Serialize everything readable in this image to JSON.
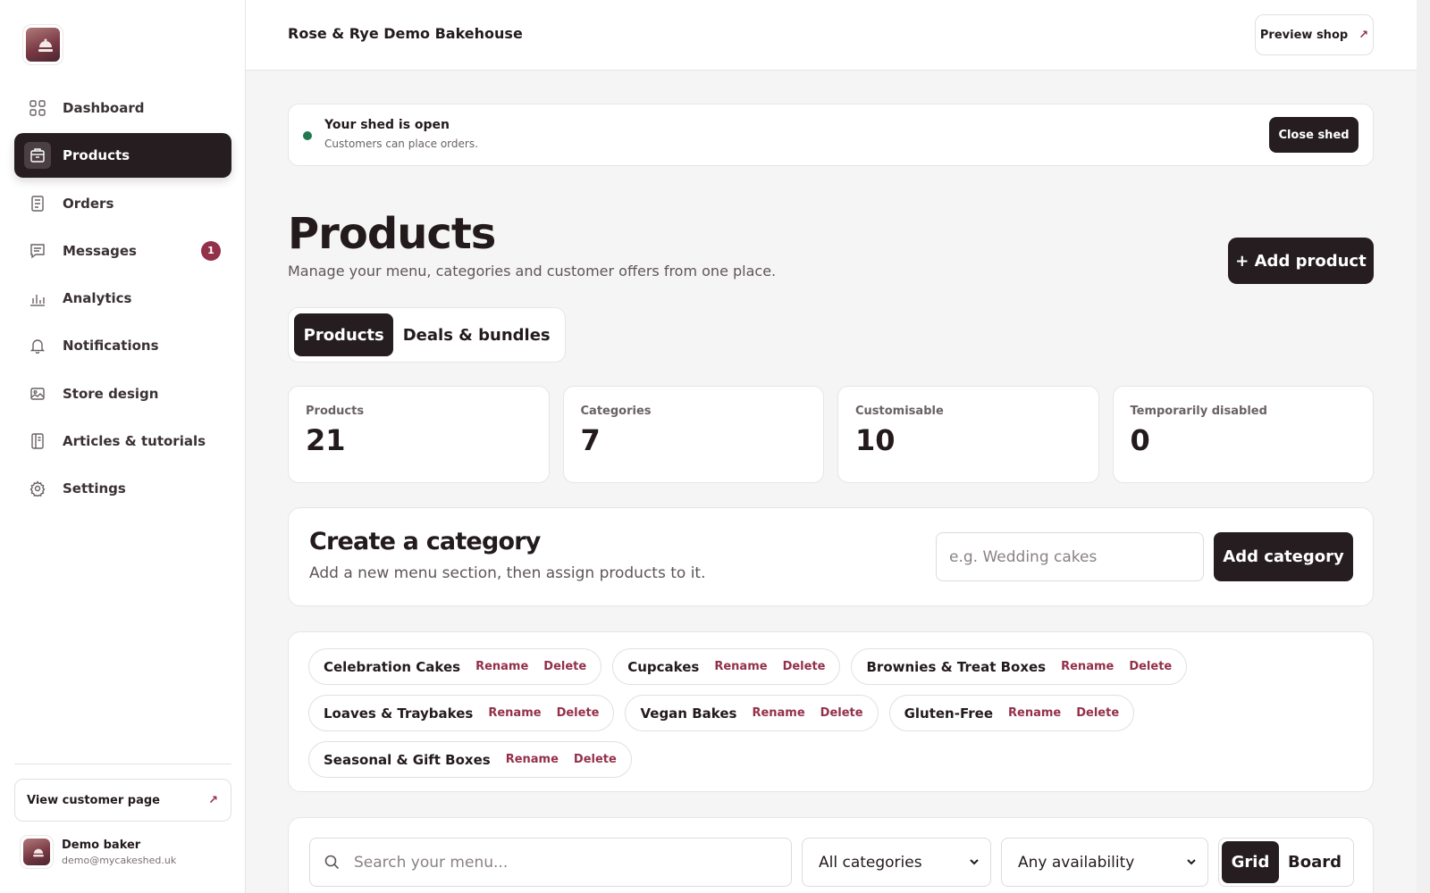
{
  "app": {
    "shop_name": "Rose & Rye Demo Bakehouse",
    "preview_label": "Preview shop",
    "accent": "#93304a",
    "dark": "#251d1f"
  },
  "sidebar": {
    "items": [
      {
        "label": "Dashboard",
        "icon": "grid-icon",
        "active": false
      },
      {
        "label": "Products",
        "icon": "box-icon",
        "active": true
      },
      {
        "label": "Orders",
        "icon": "receipt-icon",
        "active": false
      },
      {
        "label": "Messages",
        "icon": "chat-icon",
        "active": false,
        "badge": "1"
      },
      {
        "label": "Analytics",
        "icon": "bar-chart-icon",
        "active": false
      },
      {
        "label": "Notifications",
        "icon": "bell-icon",
        "active": false
      },
      {
        "label": "Store design",
        "icon": "image-icon",
        "active": false
      },
      {
        "label": "Articles & tutorials",
        "icon": "book-icon",
        "active": false
      },
      {
        "label": "Settings",
        "icon": "gear-icon",
        "active": false
      }
    ],
    "view_customer_label": "View customer page",
    "user": {
      "name": "Demo baker",
      "email": "demo@mycakeshed.uk"
    }
  },
  "status": {
    "title": "Your shed is open",
    "subtitle": "Customers can place orders.",
    "button": "Close shed",
    "color": "#207a4e"
  },
  "page": {
    "title": "Products",
    "subtitle": "Manage your menu, categories and customer offers from one place.",
    "add_button": "+ Add product",
    "tabs": [
      {
        "label": "Products",
        "active": true
      },
      {
        "label": "Deals & bundles",
        "active": false
      }
    ]
  },
  "stats": [
    {
      "label": "Products",
      "value": "21"
    },
    {
      "label": "Categories",
      "value": "7"
    },
    {
      "label": "Customisable",
      "value": "10"
    },
    {
      "label": "Temporarily disabled",
      "value": "0"
    }
  ],
  "create_category": {
    "title": "Create a category",
    "subtitle": "Add a new menu section, then assign products to it.",
    "placeholder": "e.g. Wedding cakes",
    "button": "Add category"
  },
  "categories": {
    "rename_label": "Rename",
    "delete_label": "Delete",
    "items": [
      "Celebration Cakes",
      "Cupcakes",
      "Brownies & Treat Boxes",
      "Loaves & Traybakes",
      "Vegan Bakes",
      "Gluten-Free",
      "Seasonal & Gift Boxes"
    ]
  },
  "filters": {
    "search_placeholder": "Search your menu...",
    "category_value": "All categories",
    "availability_value": "Any availability",
    "view_options": [
      "Grid",
      "Board"
    ],
    "view_active": "Grid"
  }
}
